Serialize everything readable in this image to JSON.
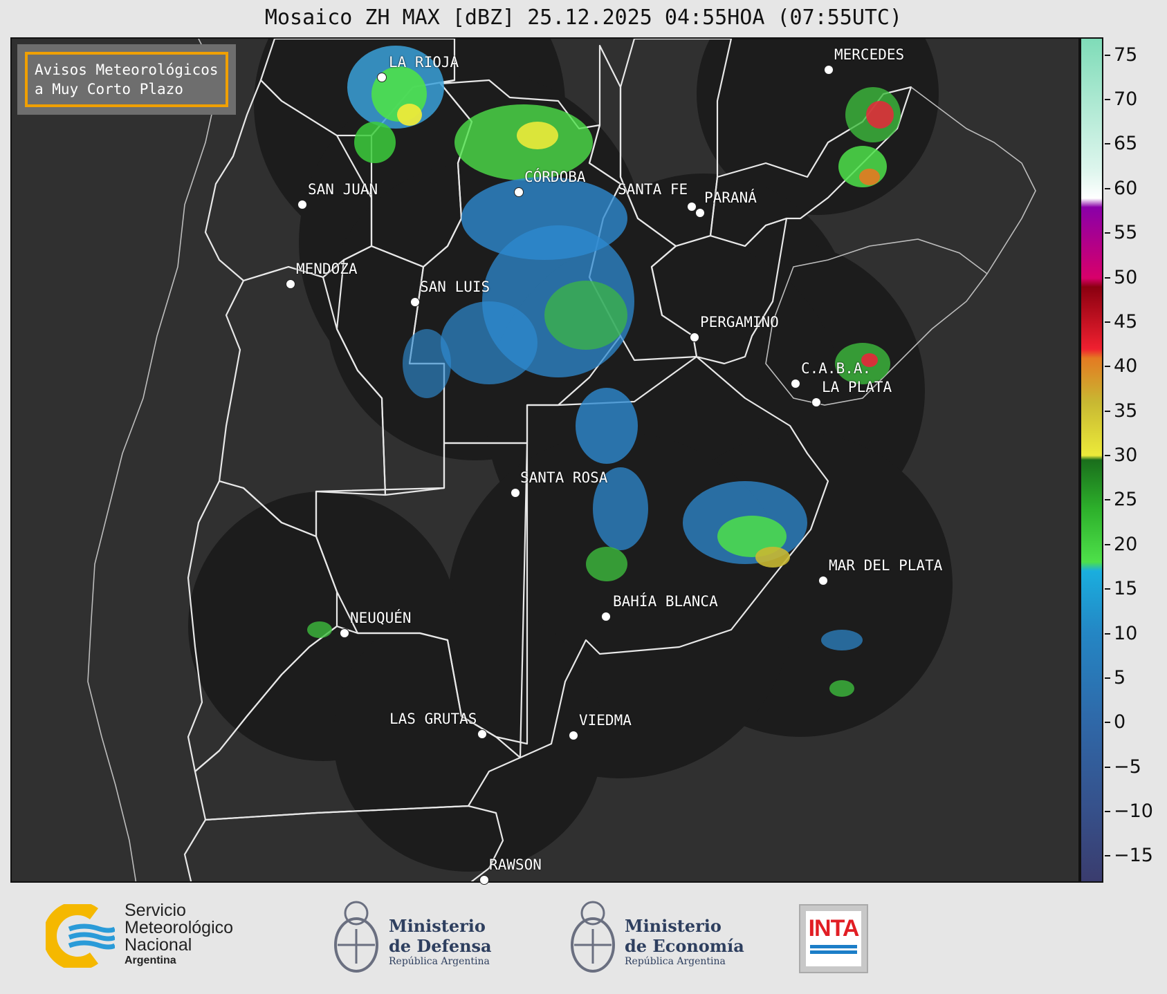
{
  "title": "Mosaico ZH MAX [dBZ] 25.12.2025 04:55HOA (07:55UTC)",
  "notice": {
    "line1": "Avisos Meteorológicos",
    "line2": "a Muy Corto Plazo",
    "border_color": "#f0a000"
  },
  "colorbar": {
    "unit": "dBZ",
    "ticks": [
      "75",
      "70",
      "65",
      "60",
      "55",
      "50",
      "45",
      "40",
      "35",
      "30",
      "25",
      "20",
      "15",
      "10",
      "5",
      "0",
      "−5",
      "−10",
      "−15"
    ],
    "stops": [
      {
        "dbz": -18,
        "color": "#3a3c6e"
      },
      {
        "dbz": -10,
        "color": "#36508a"
      },
      {
        "dbz": 0,
        "color": "#2f68a8"
      },
      {
        "dbz": 10,
        "color": "#2486c4"
      },
      {
        "dbz": 17,
        "color": "#1aaede"
      },
      {
        "dbz": 18,
        "color": "#4ee04a"
      },
      {
        "dbz": 24,
        "color": "#2db02b"
      },
      {
        "dbz": 29.5,
        "color": "#1a6e1c"
      },
      {
        "dbz": 30,
        "color": "#ecea3a"
      },
      {
        "dbz": 36,
        "color": "#c8b832"
      },
      {
        "dbz": 41,
        "color": "#e47a22"
      },
      {
        "dbz": 42,
        "color": "#f02030"
      },
      {
        "dbz": 49,
        "color": "#8a0010"
      },
      {
        "dbz": 50,
        "color": "#d8006a"
      },
      {
        "dbz": 58,
        "color": "#8a00a8"
      },
      {
        "dbz": 59,
        "color": "#ffffff"
      },
      {
        "dbz": 62,
        "color": "#dff6ee"
      },
      {
        "dbz": 77,
        "color": "#7fdcb8"
      }
    ]
  },
  "cities": [
    {
      "name": "LA RIOJA"
    },
    {
      "name": "SAN JUAN"
    },
    {
      "name": "CÓRDOBA"
    },
    {
      "name": "SANTA FE"
    },
    {
      "name": "PARANÁ"
    },
    {
      "name": "MENDOZA"
    },
    {
      "name": "SAN LUIS"
    },
    {
      "name": "MERCEDES"
    },
    {
      "name": "PERGAMINO"
    },
    {
      "name": "C.A.B.A."
    },
    {
      "name": "LA PLATA"
    },
    {
      "name": "SANTA ROSA"
    },
    {
      "name": "MAR DEL PLATA"
    },
    {
      "name": "BAHÍA BLANCA"
    },
    {
      "name": "NEUQUÉN"
    },
    {
      "name": "LAS GRUTAS"
    },
    {
      "name": "VIEDMA"
    },
    {
      "name": "RAWSON"
    }
  ],
  "logos": {
    "smn": {
      "line1": "Servicio",
      "line2": "Meteorológico",
      "line3": "Nacional",
      "line4": "Argentina"
    },
    "defensa": {
      "line1": "Ministerio",
      "line2": "de Defensa",
      "line3": "República Argentina"
    },
    "economia": {
      "line1": "Ministerio",
      "line2": "de Economía",
      "line3": "República Argentina"
    },
    "inta": {
      "text": "INTA"
    }
  }
}
